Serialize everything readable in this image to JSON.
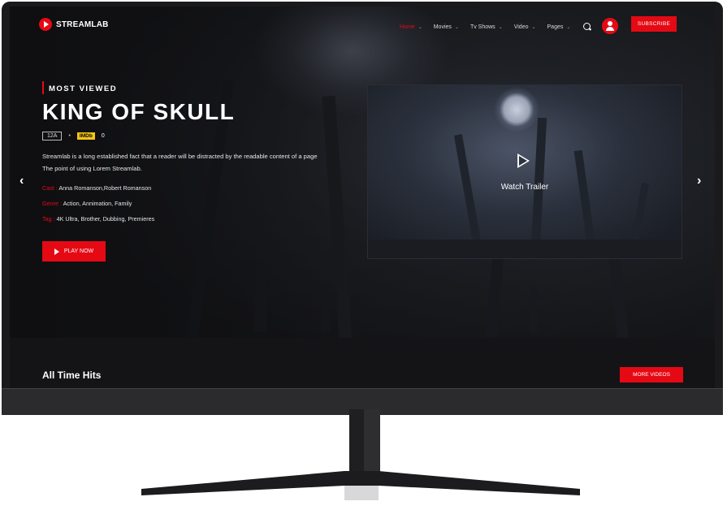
{
  "header": {
    "logo_text": "STREAMLAB",
    "nav": [
      {
        "label": "Home",
        "active": true
      },
      {
        "label": "Movies",
        "active": false
      },
      {
        "label": "Tv Shows",
        "active": false
      },
      {
        "label": "Video",
        "active": false
      },
      {
        "label": "Pages",
        "active": false
      }
    ],
    "subscribe_label": "SUBSCRIBE"
  },
  "hero": {
    "eyebrow": "MOST VIEWED",
    "title": "KING OF SKULL",
    "rating": "12A",
    "separator": "•",
    "imdb_label": "IMDb",
    "imdb_score": "0",
    "description_line1": "Streamlab is a long established fact that a reader will be distracted by the readable content of a page",
    "description_line2": "The point of using Lorem Streamlab.",
    "cast_label": "Cast :",
    "cast_value": "Anna Romanson,Robert Romanson",
    "genre_label": "Genre :",
    "genre_value": "Action, Annimation, Family",
    "tag_label": "Tag :",
    "tag_value": "4K Ultra, Brother, Dubbing, Premieres",
    "play_label": "PLAY NOW",
    "prev_arrow": "‹",
    "next_arrow": "›"
  },
  "trailer": {
    "label": "Watch Trailer"
  },
  "section": {
    "title": "All Time Hits",
    "more_label": "MORE VIDEOS"
  },
  "colors": {
    "accent": "#e50914",
    "imdb": "#f5c518",
    "background": "#141416"
  }
}
